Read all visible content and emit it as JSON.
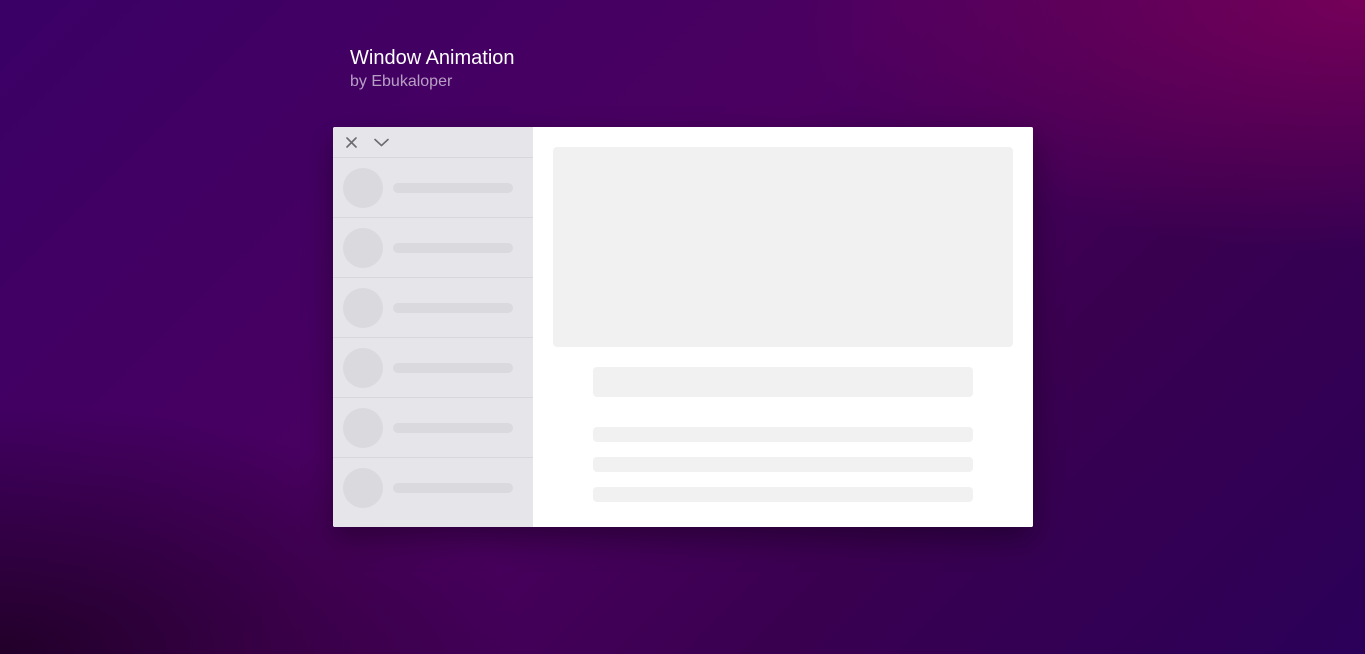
{
  "header": {
    "title": "Window Animation",
    "byline": "by Ebukaloper"
  },
  "window": {
    "toolbar": {
      "close_icon": "close-icon",
      "collapse_icon": "chevron-down-icon"
    },
    "sidebar_item_count": 6
  },
  "colors": {
    "background_top_right": "#780058",
    "background_base": "#3a0066",
    "sidebar_bg": "#e6e6ea",
    "placeholder_sidebar": "#d9d9de",
    "placeholder_main": "#f1f1f1",
    "window_bg": "#ffffff"
  }
}
